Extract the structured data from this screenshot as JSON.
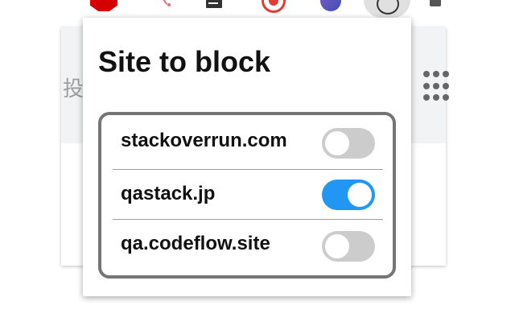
{
  "background": {
    "partial_text": "投"
  },
  "toolbar": {
    "icons": [
      "stop-sign-icon",
      "branch-icon",
      "document-icon",
      "target-icon",
      "orb-icon",
      "active-extension-icon",
      "puzzle-icon"
    ]
  },
  "popup": {
    "title": "Site to block",
    "sites": [
      {
        "label": "stackoverrun.com",
        "enabled": false
      },
      {
        "label": "qastack.jp",
        "enabled": true
      },
      {
        "label": "qa.codeflow.site",
        "enabled": false
      }
    ]
  },
  "colors": {
    "toggle_on": "#2196f3",
    "toggle_off": "#cccccc",
    "box_border": "#757575"
  }
}
